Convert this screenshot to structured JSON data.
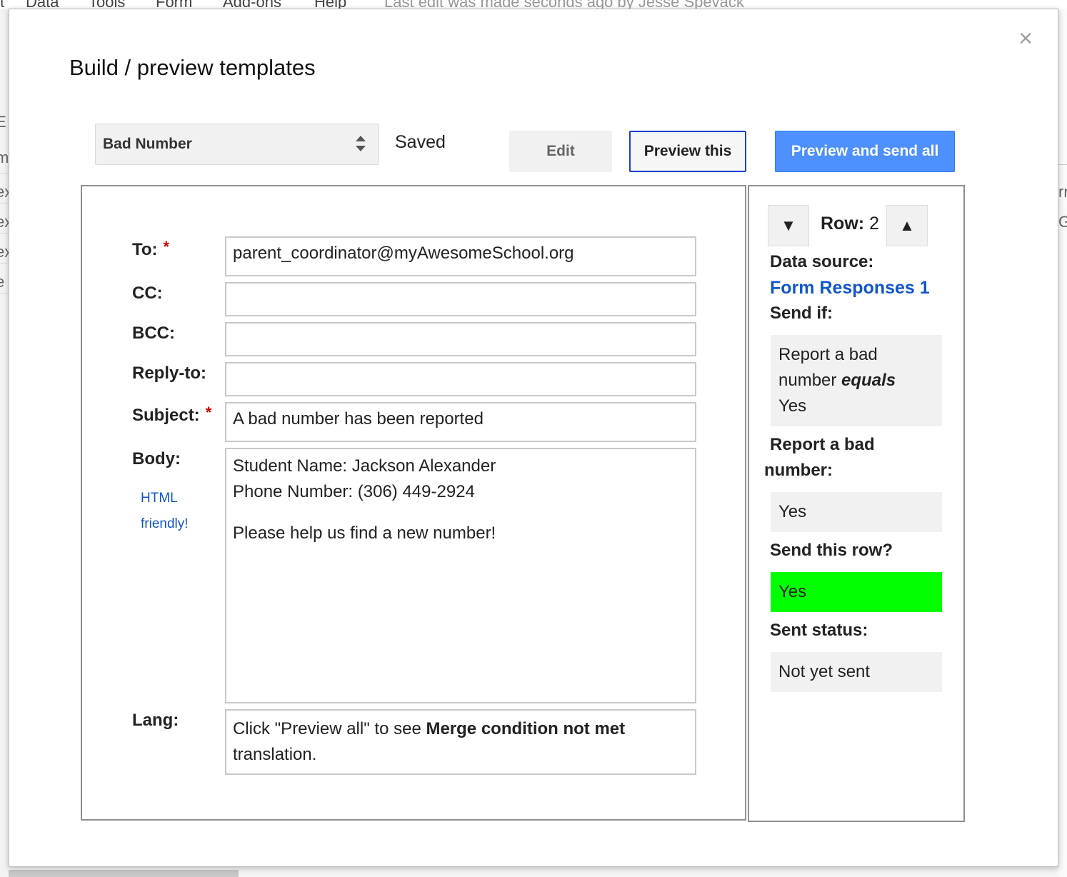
{
  "background": {
    "menu": [
      "Data",
      "Tools",
      "Form",
      "Add-ons",
      "Help"
    ],
    "last_edit": "Last edit was made seconds ago by Jesse Spevack",
    "left_fragments": [
      "E",
      "m",
      "ex",
      "ex",
      "ex",
      "e"
    ],
    "right_fragments": [
      "rr",
      "G"
    ]
  },
  "dialog": {
    "title": "Build / preview templates",
    "close_icon": "close-icon",
    "template_select": {
      "value": "Bad Number"
    },
    "status": "Saved",
    "buttons": {
      "edit": "Edit",
      "preview_this": "Preview this",
      "preview_send_all": "Preview and send all"
    }
  },
  "form": {
    "to_label": "To:",
    "to_value": "parent_coordinator@myAwesomeSchool.org",
    "cc_label": "CC:",
    "cc_value": "",
    "bcc_label": "BCC:",
    "bcc_value": "",
    "replyto_label": "Reply-to:",
    "replyto_value": "",
    "subject_label": "Subject:",
    "subject_value": "A bad number has been reported",
    "body_label": "Body:",
    "html_link_1": "HTML",
    "html_link_2": "friendly!",
    "body_lines": [
      "Student Name: Jackson Alexander",
      "Phone Number: (306) 449-2924",
      "",
      "Please help us find a new number!"
    ],
    "lang_label": "Lang:",
    "lang_text_1": "Click \"Preview all\" to see ",
    "lang_text_bold": "Merge condition not met",
    "lang_text_2": "translation.",
    "required_mark": "*"
  },
  "side": {
    "row_down": "▼",
    "row_up": "▲",
    "row_label": "Row:",
    "row_number": "2",
    "data_source_label": "Data source:",
    "data_source_link": "Form Responses 1",
    "send_if_label": "Send if:",
    "send_if_line1": "Report a bad",
    "send_if_line2a": "number ",
    "send_if_line2b": "equals",
    "send_if_line3": "Yes",
    "report_label_1": "Report a bad",
    "report_label_2": "number:",
    "report_value": "Yes",
    "send_row_label": "Send this row?",
    "send_row_value": "Yes",
    "send_row_color": "#00ff00",
    "sent_status_label": "Sent status:",
    "sent_status_value": "Not yet sent"
  }
}
